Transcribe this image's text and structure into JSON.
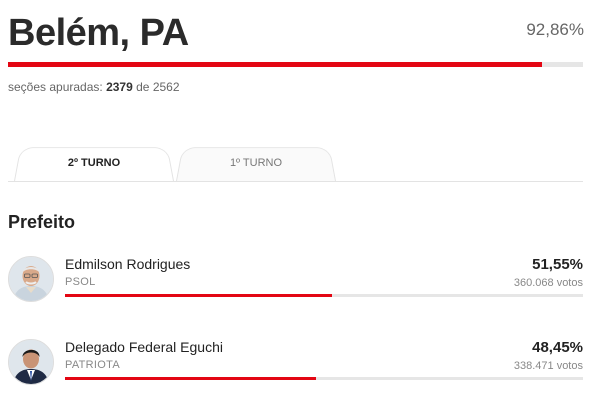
{
  "header": {
    "city": "Belém, PA",
    "percent_text": "92,86%",
    "progress_fraction": 0.9286
  },
  "sections": {
    "label": "seções apuradas:",
    "counted": "2379",
    "of": "de",
    "total": "2562"
  },
  "tabs": [
    {
      "label": "2º TURNO",
      "active": true
    },
    {
      "label": "1º TURNO",
      "active": false
    }
  ],
  "office": "Prefeito",
  "candidates": [
    {
      "name": "Edmilson Rodrigues",
      "party": "PSOL",
      "percent_text": "51,55%",
      "votes_text": "360.068 votos",
      "share": 0.5155
    },
    {
      "name": "Delegado Federal Eguchi",
      "party": "PATRIOTA",
      "percent_text": "48,45%",
      "votes_text": "338.471 votos",
      "share": 0.4845
    }
  ],
  "colors": {
    "accent": "#e30613",
    "track": "#e6e6e6"
  }
}
